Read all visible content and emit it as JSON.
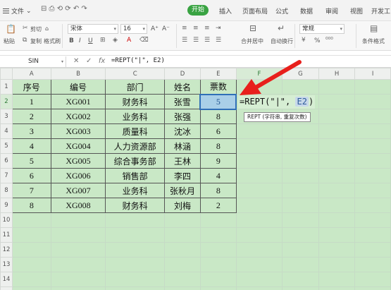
{
  "menubar": {
    "file_label": "文件",
    "quick_icons": "⊟ ⎙ ⟲ ⟳ ↶ ↷",
    "tabs": [
      "开始",
      "插入",
      "页面布局",
      "公式",
      "数据",
      "审阅",
      "视图",
      "开发工"
    ]
  },
  "ribbon": {
    "paste_label": "粘贴",
    "cut_label": "剪切",
    "copy_label": "复制",
    "format_painter_label": "格式刷",
    "font_name": "宋体",
    "font_size": "16",
    "grow_label": "A⁺",
    "shrink_label": "A⁻",
    "bold_label": "B",
    "italic_label": "I",
    "underline_label": "U",
    "merge_center_label": "合并居中",
    "wrap_text_label": "自动换行",
    "number_format": "常规",
    "percent_label": "%",
    "conditional_format_label": "条件格式"
  },
  "formula_bar": {
    "name_box": "SIN",
    "cancel_icon": "✕",
    "enter_icon": "✓",
    "fx_label": "fx",
    "content": "=REPT(\"|\", E2)"
  },
  "sheet": {
    "columns": [
      "A",
      "B",
      "C",
      "D",
      "E",
      "F",
      "G",
      "H",
      "I"
    ],
    "rows": [
      "1",
      "2",
      "3",
      "4",
      "5",
      "6",
      "7",
      "8",
      "9",
      "10",
      "11",
      "12",
      "13",
      "14",
      "15"
    ],
    "headers": [
      "序号",
      "编号",
      "部门",
      "姓名",
      "票数"
    ],
    "data": [
      [
        "1",
        "XG001",
        "财务科",
        "张雪",
        "5"
      ],
      [
        "2",
        "XG002",
        "业务科",
        "张强",
        "8"
      ],
      [
        "3",
        "XG003",
        "质量科",
        "沈冰",
        "6"
      ],
      [
        "4",
        "XG004",
        "人力资源部",
        "林涵",
        "8"
      ],
      [
        "5",
        "XG005",
        "综合事务部",
        "王林",
        "9"
      ],
      [
        "6",
        "XG006",
        "销售部",
        "李四",
        "4"
      ],
      [
        "7",
        "XG007",
        "业务科",
        "张秋月",
        "8"
      ],
      [
        "8",
        "XG008",
        "财务科",
        "刘梅",
        "2"
      ]
    ],
    "active_cell": "F2",
    "edit_prefix": "=REPT(\"|\", ",
    "edit_ref": "E2",
    "edit_suffix": ")",
    "tooltip": "REPT (字符串, 重复次数)"
  },
  "colors": {
    "accent": "#39a342",
    "cell_fill": "#c9e8c6",
    "arrow": "#e8201c"
  }
}
